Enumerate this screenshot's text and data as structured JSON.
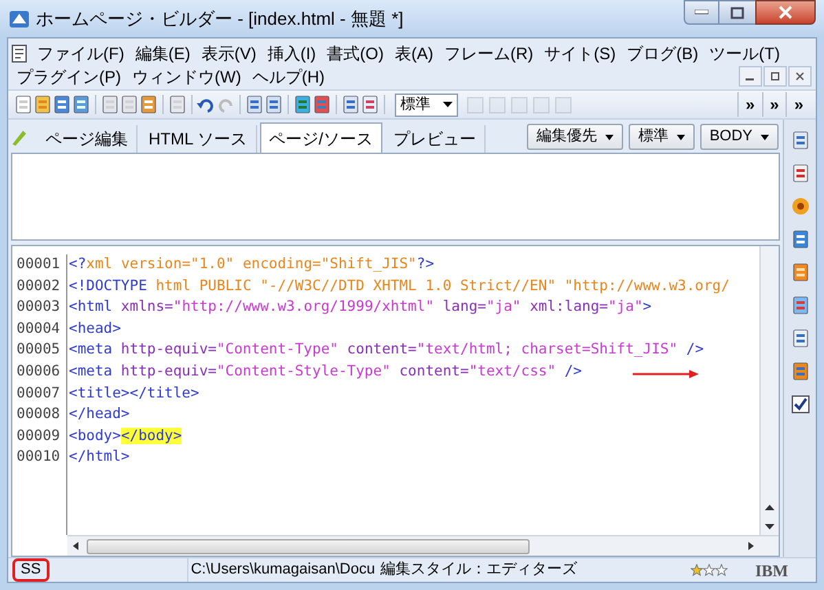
{
  "window": {
    "title": "ホームページ・ビルダー - [index.html - 無題 *]"
  },
  "menu": {
    "items": [
      "ファイル(F)",
      "編集(E)",
      "表示(V)",
      "挿入(I)",
      "書式(O)",
      "表(A)",
      "フレーム(R)",
      "サイト(S)",
      "ブログ(B)",
      "ツール(T)"
    ],
    "second_line_items": [
      "プラグイン(P)",
      "ウィンドウ(W)",
      "ヘルプ(H)"
    ]
  },
  "toolbar": {
    "style_combo": "標準",
    "overflow": [
      "»",
      "»",
      "»"
    ]
  },
  "tabs": [
    {
      "label": "ページ編集",
      "selected": false
    },
    {
      "label": "HTML ソース",
      "selected": false
    },
    {
      "label": "ページ/ソース",
      "selected": true
    },
    {
      "label": "プレビュー",
      "selected": false
    }
  ],
  "mode_dropdowns": [
    "編集優先",
    "標準",
    "BODY"
  ],
  "code": {
    "lines": [
      {
        "number": "00001",
        "segments": [
          {
            "kind": "tag",
            "text": "<?"
          },
          {
            "kind": "decl",
            "text": "xml version=\"1.0\" encoding=\"Shift_JIS\""
          },
          {
            "kind": "tag",
            "text": "?>"
          }
        ]
      },
      {
        "number": "00002",
        "segments": [
          {
            "kind": "tag",
            "text": "<!DOCTYPE"
          },
          {
            "kind": "decl",
            "text": " html PUBLIC \"-//W3C//DTD XHTML 1.0 Strict//EN\" \"http://www.w3.org/"
          }
        ]
      },
      {
        "number": "00003",
        "segments": [
          {
            "kind": "tag",
            "text": "<html"
          },
          {
            "kind": "attr",
            "text": " xmlns="
          },
          {
            "kind": "value",
            "text": "\"http://www.w3.org/1999/xhtml\""
          },
          {
            "kind": "attr",
            "text": " lang="
          },
          {
            "kind": "value",
            "text": "\"ja\""
          },
          {
            "kind": "attr",
            "text": " xml:lang="
          },
          {
            "kind": "value",
            "text": "\"ja\""
          },
          {
            "kind": "tag",
            "text": ">"
          }
        ]
      },
      {
        "number": "00004",
        "segments": [
          {
            "kind": "tag",
            "text": "<head>"
          }
        ]
      },
      {
        "number": "00005",
        "segments": [
          {
            "kind": "tag",
            "text": "<meta"
          },
          {
            "kind": "attr",
            "text": " http-equiv="
          },
          {
            "kind": "value",
            "text": "\"Content-Type\""
          },
          {
            "kind": "attr",
            "text": " content="
          },
          {
            "kind": "value",
            "text": "\"text/html; charset=Shift_JIS\""
          },
          {
            "kind": "tag",
            "text": " />"
          }
        ]
      },
      {
        "number": "00006",
        "segments": [
          {
            "kind": "tag",
            "text": "<meta"
          },
          {
            "kind": "attr",
            "text": " http-equiv="
          },
          {
            "kind": "value",
            "text": "\"Content-Style-Type\""
          },
          {
            "kind": "attr",
            "text": " content="
          },
          {
            "kind": "value",
            "text": "\"text/css\""
          },
          {
            "kind": "tag",
            "text": " />"
          }
        ]
      },
      {
        "number": "00007",
        "segments": [
          {
            "kind": "tag",
            "text": "<title></title>"
          }
        ]
      },
      {
        "number": "00008",
        "segments": [
          {
            "kind": "tag",
            "text": "</head>"
          }
        ]
      },
      {
        "number": "00009",
        "segments": [
          {
            "kind": "tag",
            "text": "<body>"
          },
          {
            "kind": "highlight",
            "text": "</body>"
          }
        ]
      },
      {
        "number": "00010",
        "segments": [
          {
            "kind": "tag",
            "text": "</html>"
          }
        ]
      }
    ]
  },
  "status_bar": {
    "mode": "SS",
    "path": "C:\\Users\\kumagaisan\\Docu",
    "edit_style": "編集スタイル：エディターズ",
    "stars": 1,
    "brand": "IBM"
  }
}
